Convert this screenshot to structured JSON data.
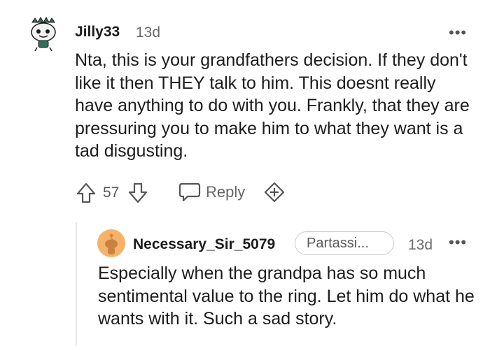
{
  "comment": {
    "username": "Jilly33",
    "age": "13d",
    "more_label": "•••",
    "body": "Nta, this is your grandfathers decision. If they don't like it then THEY talk to him. This doesnt really have anything to do with you. Frankly, that they are pressuring you to make him to what they want is a tad disgusting.",
    "votes": "57",
    "reply_label": "Reply"
  },
  "reply": {
    "username": "Necessary_Sir_5079",
    "flair": "Partassi...",
    "age": "13d",
    "more_label": "•••",
    "body": "Especially when the grandpa has so much sentimental value to the ring. Let him do what he wants with it. Such a sad story."
  },
  "icons": {
    "upvote": "upvote-arrow-icon",
    "downvote": "downvote-arrow-icon",
    "reply": "speech-bubble-icon",
    "award": "add-award-icon"
  },
  "colors": {
    "text": "#1c1c1c",
    "meta": "#6a6a6a",
    "icon": "#555555",
    "reply_avatar_bg": "#f5b26b"
  }
}
